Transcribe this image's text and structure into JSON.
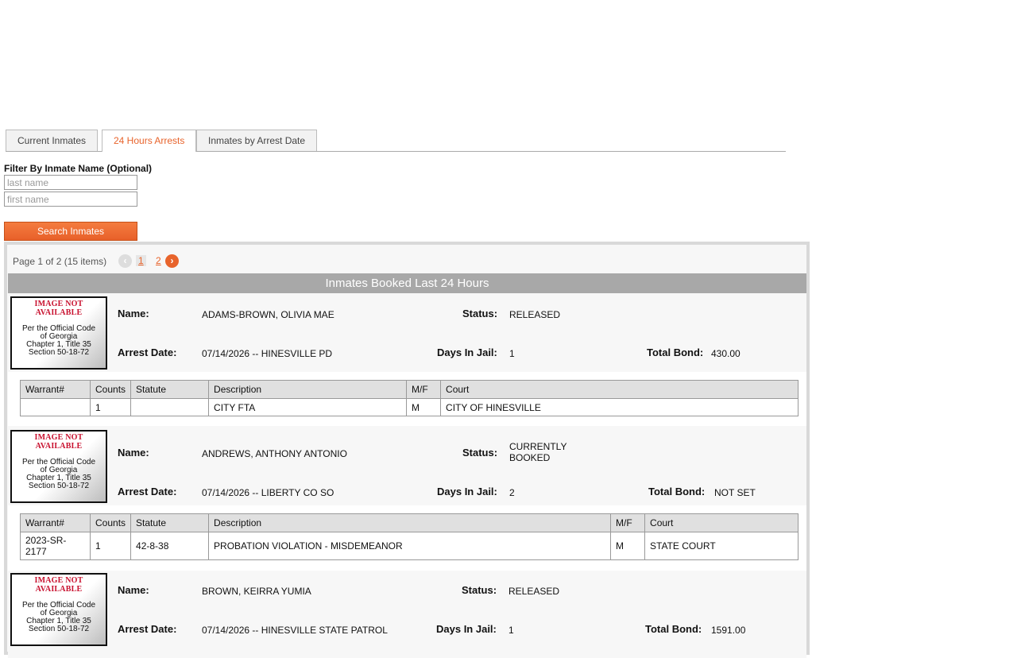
{
  "tabs": [
    {
      "label": "Current Inmates"
    },
    {
      "label": "24 Hours Arrests"
    },
    {
      "label": "Inmates by Arrest Date"
    }
  ],
  "filter": {
    "label": "Filter By Inmate Name (Optional)",
    "last_placeholder": "last name",
    "first_placeholder": "first name",
    "search_label": "Search Inmates"
  },
  "pager": {
    "text": "Page 1 of 2 (15 items)",
    "pages": [
      "1",
      "2"
    ],
    "prev_glyph": "‹",
    "next_glyph": "›"
  },
  "section_title": "Inmates Booked Last 24 Hours",
  "labels": {
    "name": "Name:",
    "status": "Status:",
    "arrest_date": "Arrest Date:",
    "days_in_jail": "Days In Jail:",
    "total_bond": "Total Bond:"
  },
  "mugshot": {
    "top": "IMAGE NOT AVAILABLE",
    "line1": "Per the Official Code",
    "line2": "of Georgia",
    "line3": "Chapter 1, Title 35",
    "line4": "Section 50-18-72"
  },
  "warrant_headers": [
    "Warrant#",
    "Counts",
    "Statute",
    "Description",
    "M/F",
    "Court"
  ],
  "inmates": [
    {
      "name": "ADAMS-BROWN, OLIVIA MAE",
      "status": "RELEASED",
      "arrest_date": "07/14/2026 -- HINESVILLE PD",
      "days_in_jail": "1",
      "total_bond": "430.00",
      "warrants": [
        {
          "warrant": "",
          "counts": "1",
          "statute": "",
          "description": "CITY FTA",
          "mf": "M",
          "court": "CITY OF HINESVILLE"
        }
      ]
    },
    {
      "name": "ANDREWS, ANTHONY ANTONIO",
      "status": "CURRENTLY BOOKED",
      "arrest_date": "07/14/2026 -- LIBERTY CO SO",
      "days_in_jail": "2",
      "total_bond": "NOT SET",
      "warrants": [
        {
          "warrant": "2023-SR-2177",
          "counts": "1",
          "statute": "42-8-38",
          "description": "PROBATION VIOLATION - MISDEMEANOR",
          "mf": "M",
          "court": "STATE COURT"
        }
      ]
    },
    {
      "name": "BROWN, KEIRRA YUMIA",
      "status": "RELEASED",
      "arrest_date": "07/14/2026 -- HINESVILLE STATE PATROL",
      "days_in_jail": "1",
      "total_bond": "1591.00",
      "warrants": []
    }
  ],
  "colors": {
    "accent": "#e8642c",
    "title_bar": "#a8a8a8",
    "mugshot_red": "#c8102e"
  }
}
